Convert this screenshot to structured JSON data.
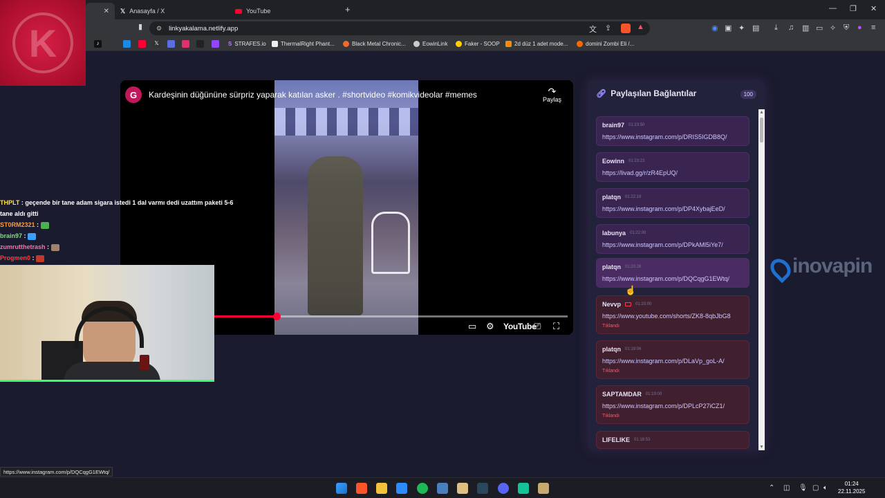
{
  "browser": {
    "tabs": [
      {
        "label": "",
        "active": true
      },
      {
        "label": "Anasayfa / X",
        "icon": "x-icon"
      },
      {
        "label": "YouTube",
        "icon": "youtube-icon"
      }
    ],
    "url": "linkyakalama.netlify.app",
    "bookmarks": [
      "STRAFES.io",
      "ThermalRight Phant...",
      "Black Metal Chronic...",
      "EowinLink",
      "Faker - SOOP",
      "2d düz 1 adet mode...",
      "domini Zombi Eli /..."
    ]
  },
  "video": {
    "avatar_letter": "G",
    "title": "Kardeşinin düğününe sürpriz yaparak katılan asker . #shortvideo #komikvideolar #memes",
    "share_label": "Paylaş",
    "youtube_label": "YouTube",
    "progress_fraction": 0.35
  },
  "panel": {
    "title": "Paylaşılan Bağlantılar",
    "count": "100",
    "accent": "#7c4dff",
    "items": [
      {
        "user": "brain97",
        "time": "01:23:50",
        "url": "https://www.instagram.com/p/DRIS5IGDB8Q/",
        "clicked": "",
        "style": "purple"
      },
      {
        "user": "Eowinn",
        "time": "01:23:23",
        "url": "https://livad.gg/r/zR4EpUQ/",
        "clicked": "",
        "style": "purple"
      },
      {
        "user": "platqn",
        "time": "01:22:19",
        "url": "https://www.instagram.com/p/DP4XybajEeD/",
        "clicked": "",
        "style": "purple"
      },
      {
        "user": "labunya",
        "time": "01:22:00",
        "url": "https://www.instagram.com/p/DPkAMl5iYe7/",
        "clicked": "",
        "style": "purple"
      },
      {
        "user": "platqn",
        "time": "01:20:26",
        "url": "https://www.instagram.com/p/DQCqgG1EWtq/",
        "clicked": "",
        "style": "purple"
      },
      {
        "user": "Nevvp",
        "time": "01:20:00",
        "url": "https://www.youtube.com/shorts/ZK8-8qbJbG8",
        "clicked": "Tıklandı",
        "style": "red",
        "yt": true
      },
      {
        "user": "platqn",
        "time": "01:19:06",
        "url": "https://www.instagram.com/p/DLaVp_goL-A/",
        "clicked": "Tıklandı",
        "style": "red"
      },
      {
        "user": "SAPTAMDAR",
        "time": "01:19:00",
        "url": "https://www.instagram.com/p/DPLcP27iCZ1/",
        "clicked": "Tıklandı",
        "style": "red"
      },
      {
        "user": "LIFELIKE",
        "time": "01:18:53",
        "url": "",
        "clicked": "",
        "style": "red"
      }
    ]
  },
  "chat": [
    {
      "user": "THPLT",
      "color": "#ffe14d",
      "text": "geçende bir tane adam sigara istedi 1 dal varmı dedi uzattım paketi 5-6"
    },
    {
      "user": "",
      "color": "#ffffff",
      "text": "tane aldı gitti"
    },
    {
      "user": "ST0RM2321",
      "color": "#ff9a3c",
      "text": "",
      "emote": "#4caf50"
    },
    {
      "user": "brain97",
      "color": "#7be07b",
      "text": "",
      "emote": "#3aa0ff"
    },
    {
      "user": "zumrutthetrash",
      "color": "#ff6fa8",
      "text": "",
      "emote": "#a0826d"
    },
    {
      "user": "Progmen0",
      "color": "#ff3b3b",
      "text": "",
      "emote": "#c0392b"
    }
  ],
  "overlay": {
    "brand_text": "inovapin"
  },
  "status_url": "https://www.instagram.com/p/DQCqgG1EWtq/",
  "clock": {
    "time": "01:24",
    "date": "22.11.2025"
  }
}
